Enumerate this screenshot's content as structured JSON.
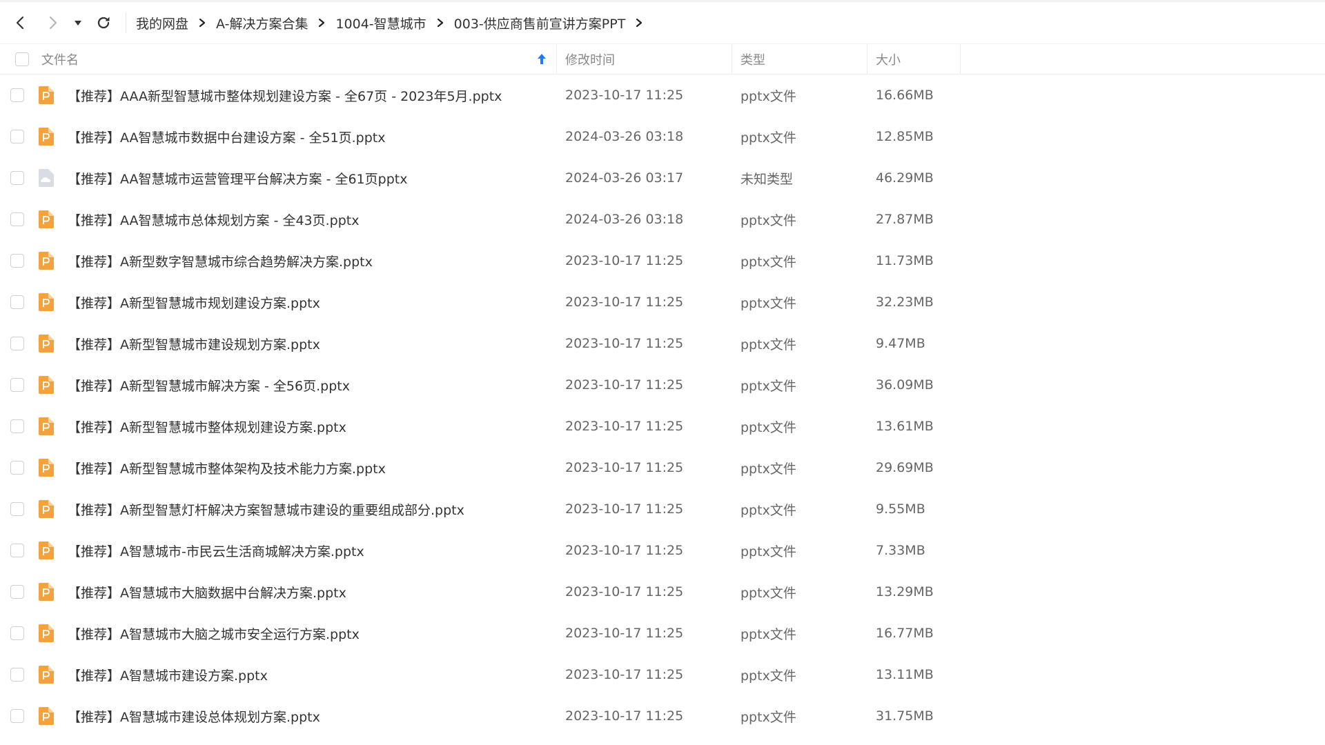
{
  "breadcrumb": [
    {
      "label": "我的网盘"
    },
    {
      "label": "A-解决方案合集"
    },
    {
      "label": "1004-智慧城市"
    },
    {
      "label": "003-供应商售前宣讲方案PPT"
    }
  ],
  "columns": {
    "name": "文件名",
    "mtime": "修改时间",
    "type": "类型",
    "size": "大小"
  },
  "sort": {
    "column": "name",
    "direction": "ascending",
    "icon": "arrow-up-icon"
  },
  "colors": {
    "accent": "#1e7bff",
    "pptx_icon": "#f5a23c",
    "unknown_icon": "#d8dde3"
  },
  "files": [
    {
      "name": "【推荐】AAA新型智慧城市整体规划建设方案 - 全67页 - 2023年5月.pptx",
      "mtime": "2023-10-17 11:25",
      "type": "pptx文件",
      "size": "16.66MB",
      "icon": "pptx-file-icon"
    },
    {
      "name": "【推荐】AA智慧城市数据中台建设方案 - 全51页.pptx",
      "mtime": "2024-03-26 03:18",
      "type": "pptx文件",
      "size": "12.85MB",
      "icon": "pptx-file-icon"
    },
    {
      "name": "【推荐】AA智慧城市运营管理平台解决方案 - 全61页pptx",
      "mtime": "2024-03-26 03:17",
      "type": "未知类型",
      "size": "46.29MB",
      "icon": "unknown-file-icon"
    },
    {
      "name": "【推荐】AA智慧城市总体规划方案 - 全43页.pptx",
      "mtime": "2024-03-26 03:18",
      "type": "pptx文件",
      "size": "27.87MB",
      "icon": "pptx-file-icon"
    },
    {
      "name": "【推荐】A新型数字智慧城市综合趋势解决方案.pptx",
      "mtime": "2023-10-17 11:25",
      "type": "pptx文件",
      "size": "11.73MB",
      "icon": "pptx-file-icon"
    },
    {
      "name": "【推荐】A新型智慧城市规划建设方案.pptx",
      "mtime": "2023-10-17 11:25",
      "type": "pptx文件",
      "size": "32.23MB",
      "icon": "pptx-file-icon"
    },
    {
      "name": "【推荐】A新型智慧城市建设规划方案.pptx",
      "mtime": "2023-10-17 11:25",
      "type": "pptx文件",
      "size": "9.47MB",
      "icon": "pptx-file-icon"
    },
    {
      "name": "【推荐】A新型智慧城市解决方案 - 全56页.pptx",
      "mtime": "2023-10-17 11:25",
      "type": "pptx文件",
      "size": "36.09MB",
      "icon": "pptx-file-icon"
    },
    {
      "name": "【推荐】A新型智慧城市整体规划建设方案.pptx",
      "mtime": "2023-10-17 11:25",
      "type": "pptx文件",
      "size": "13.61MB",
      "icon": "pptx-file-icon"
    },
    {
      "name": "【推荐】A新型智慧城市整体架构及技术能力方案.pptx",
      "mtime": "2023-10-17 11:25",
      "type": "pptx文件",
      "size": "29.69MB",
      "icon": "pptx-file-icon"
    },
    {
      "name": "【推荐】A新型智慧灯杆解决方案智慧城市建设的重要组成部分.pptx",
      "mtime": "2023-10-17 11:25",
      "type": "pptx文件",
      "size": "9.55MB",
      "icon": "pptx-file-icon"
    },
    {
      "name": "【推荐】A智慧城市-市民云生活商城解决方案.pptx",
      "mtime": "2023-10-17 11:25",
      "type": "pptx文件",
      "size": "7.33MB",
      "icon": "pptx-file-icon"
    },
    {
      "name": "【推荐】A智慧城市大脑数据中台解决方案.pptx",
      "mtime": "2023-10-17 11:25",
      "type": "pptx文件",
      "size": "13.29MB",
      "icon": "pptx-file-icon"
    },
    {
      "name": "【推荐】A智慧城市大脑之城市安全运行方案.pptx",
      "mtime": "2023-10-17 11:25",
      "type": "pptx文件",
      "size": "16.77MB",
      "icon": "pptx-file-icon"
    },
    {
      "name": "【推荐】A智慧城市建设方案.pptx",
      "mtime": "2023-10-17 11:25",
      "type": "pptx文件",
      "size": "13.11MB",
      "icon": "pptx-file-icon"
    },
    {
      "name": "【推荐】A智慧城市建设总体规划方案.pptx",
      "mtime": "2023-10-17 11:25",
      "type": "pptx文件",
      "size": "31.75MB",
      "icon": "pptx-file-icon"
    }
  ]
}
